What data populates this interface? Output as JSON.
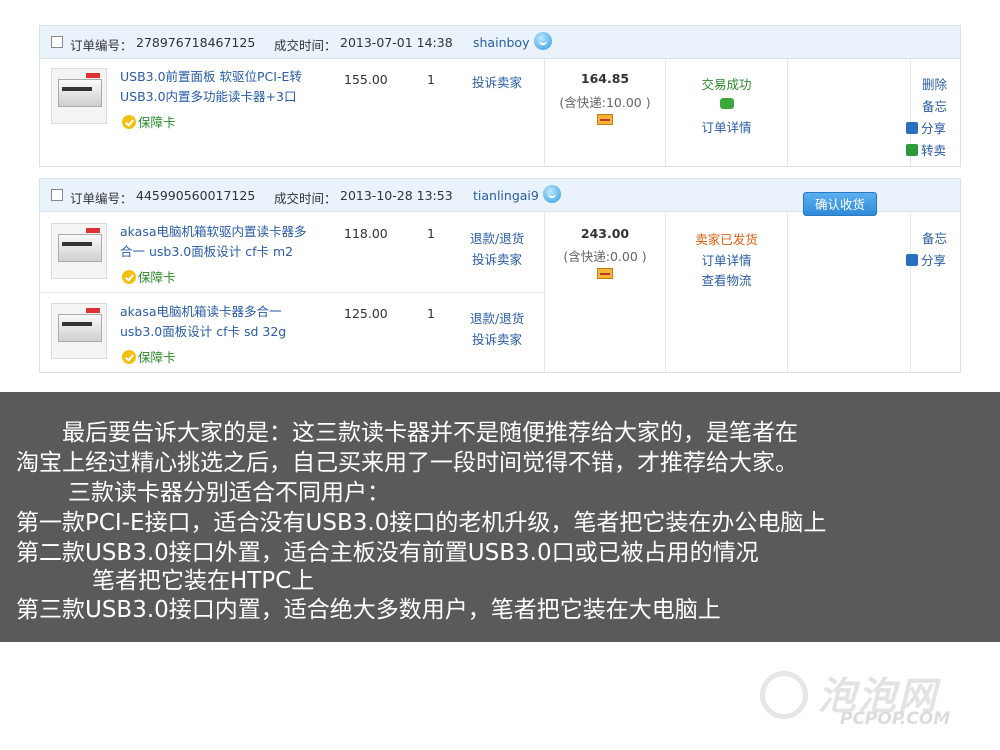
{
  "orders": [
    {
      "order_no_label": "订单编号：",
      "order_no": "278976718467125",
      "deal_time_label": "成交时间：",
      "deal_time": "2013-07-01 14:38",
      "seller": "shainboy",
      "items": [
        {
          "title_line1": "USB3.0前置面板 软驱位PCI-E转",
          "title_line2": "USB3.0内置多功能读卡器+3口",
          "badge": "保障卡",
          "price": "155.00",
          "qty": "1",
          "links": [
            "投诉卖家"
          ]
        }
      ],
      "total": "164.85",
      "shipping": "(含快递:10.00 )",
      "status": "交易成功",
      "status_color": "#2a8a2a",
      "status_links": [
        "订单详情"
      ],
      "actions": [
        "删除",
        "备忘",
        "分享",
        "转卖"
      ]
    },
    {
      "order_no_label": "订单编号：",
      "order_no": "445990560017125",
      "deal_time_label": "成交时间：",
      "deal_time": "2013-10-28 13:53",
      "seller": "tianlingai9",
      "items": [
        {
          "title_line1": "akasa电脑机箱软驱内置读卡器多",
          "title_line2": "合一 usb3.0面板设计 cf卡 m2",
          "badge": "保障卡",
          "price": "118.00",
          "qty": "1",
          "links": [
            "退款/退货",
            "投诉卖家"
          ]
        },
        {
          "title_line1": "akasa电脑机箱读卡器多合一",
          "title_line2": "usb3.0面板设计 cf卡 sd 32g",
          "badge": "保障卡",
          "price": "125.00",
          "qty": "1",
          "links": [
            "退款/退货",
            "投诉卖家"
          ]
        }
      ],
      "total": "243.00",
      "shipping": "(含快递:0.00 )",
      "status": "卖家已发货",
      "status_color": "#e06010",
      "status_links": [
        "订单详情",
        "查看物流"
      ],
      "confirm_button": "确认收货",
      "actions": [
        "备忘",
        "分享"
      ]
    }
  ],
  "caption": {
    "lines": [
      "最后要告诉大家的是：这三款读卡器并不是随便推荐给大家的，是笔者在",
      "淘宝上经过精心挑选之后，自己买来用了一段时间觉得不错，才推荐给大家。",
      "三款读卡器分别适合不同用户：",
      "第一款PCI-E接口，适合没有USB3.0接口的老机升级，笔者把它装在办公电脑上",
      "第二款USB3.0接口外置，适合主板没有前置USB3.0口或已被占用的情况",
      "笔者把它装在HTPC上",
      "第三款USB3.0接口内置，适合绝大多数用户，笔者把它装在大电脑上"
    ]
  },
  "watermark": {
    "cn": "泡泡网",
    "en": "PCPOP.COM"
  },
  "icons": {
    "wangwang": "wangwang-chat-icon",
    "shipping_card": "payment-card-icon",
    "chat": "chat-bubble-icon",
    "share": "share-icon",
    "resell": "resell-icon",
    "guarantee": "guarantee-badge-icon"
  }
}
